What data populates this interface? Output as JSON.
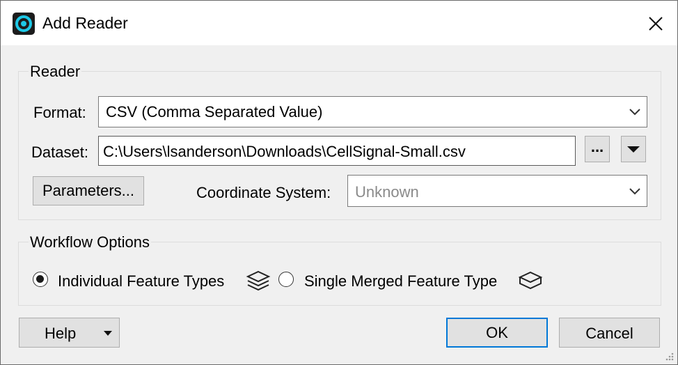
{
  "window": {
    "title": "Add Reader",
    "app_icon": "fme-logo-icon",
    "close_icon": "close-icon"
  },
  "reader_group": {
    "label": "Reader",
    "format_label": "Format:",
    "format_value": "CSV (Comma Separated Value)",
    "dataset_label": "Dataset:",
    "dataset_value": "C:\\Users\\lsanderson\\Downloads\\CellSignal-Small.csv",
    "browse_label": "...",
    "parameters_label": "Parameters...",
    "coord_label": "Coordinate System:",
    "coord_value": "Unknown"
  },
  "workflow_group": {
    "label": "Workflow Options",
    "option_individual": "Individual Feature Types",
    "option_merged": "Single Merged Feature Type",
    "selected": "individual"
  },
  "footer": {
    "help_label": "Help",
    "ok_label": "OK",
    "cancel_label": "Cancel"
  },
  "colors": {
    "accent": "#0078d7",
    "dialog_bg": "#f0f0f0",
    "icon_cyan": "#1ec8e6"
  }
}
